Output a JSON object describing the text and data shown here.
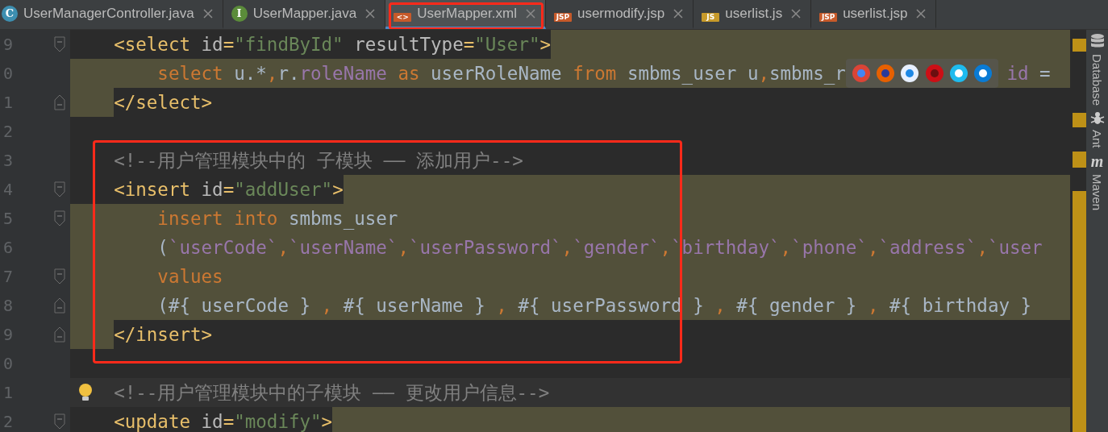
{
  "tabs": [
    {
      "label": "UserManagerController.java",
      "kind": "class",
      "icon_label": "C",
      "selected": false
    },
    {
      "label": "UserMapper.java",
      "kind": "interface",
      "icon_label": "I",
      "selected": false
    },
    {
      "label": "UserMapper.xml",
      "kind": "xml",
      "icon_label": "<>",
      "selected": true
    },
    {
      "label": "usermodify.jsp",
      "kind": "jsp",
      "icon_label": "JSP",
      "selected": false
    },
    {
      "label": "userlist.js",
      "kind": "js",
      "icon_label": "JS",
      "selected": false
    },
    {
      "label": "userlist.jsp",
      "kind": "jsp",
      "icon_label": "JSP",
      "selected": false
    }
  ],
  "editor": {
    "lines": [
      {
        "number": "9",
        "fold_start": true,
        "fold_end": false,
        "kind": "after",
        "tokens": [
          {
            "t": "    <select ",
            "kind": "tag"
          },
          {
            "t": "id",
            "kind": "attr"
          },
          {
            "t": "=",
            "kind": "tag"
          },
          {
            "t": "\"findById\"",
            "kind": "string"
          },
          {
            "t": " resultType",
            "kind": "attr"
          },
          {
            "t": "=",
            "kind": "tag"
          },
          {
            "t": "\"User\"",
            "kind": "string"
          },
          {
            "t": ">",
            "kind": "tag"
          }
        ]
      },
      {
        "number": "0",
        "fold_start": false,
        "fold_end": false,
        "kind": "full",
        "tokens": [
          {
            "t": "        select",
            "kind": "keyword"
          },
          {
            "t": " u.*",
            "kind": "plain"
          },
          {
            "t": ",",
            "kind": "keyword"
          },
          {
            "t": "r.",
            "kind": "plain"
          },
          {
            "t": "roleName",
            "kind": "field"
          },
          {
            "t": " as",
            "kind": "keyword"
          },
          {
            "t": " userRoleName ",
            "kind": "plain"
          },
          {
            "t": "from",
            "kind": "keyword"
          },
          {
            "t": " smbms_user u",
            "kind": "plain"
          },
          {
            "t": ",",
            "kind": "keyword"
          },
          {
            "t": "smbms_r",
            "kind": "plain"
          },
          {
            "kind": "browser_popup"
          },
          {
            "t": "id",
            "kind": "field"
          },
          {
            "t": " =",
            "kind": "plain"
          }
        ]
      },
      {
        "number": "1",
        "fold_start": false,
        "fold_end": true,
        "kind": "indent",
        "tokens": [
          {
            "t": "</select>",
            "kind": "tag"
          }
        ]
      },
      {
        "number": "2",
        "fold_start": false,
        "fold_end": false,
        "kind": "none"
      },
      {
        "number": "3",
        "fold_start": false,
        "fold_end": false,
        "kind": "none",
        "tokens": [
          {
            "t": "    <!--用户管理模块中的 子模块 —— 添加用户-->",
            "kind": "comment"
          }
        ]
      },
      {
        "number": "4",
        "fold_start": true,
        "fold_end": false,
        "kind": "after",
        "tokens": [
          {
            "t": "    <insert ",
            "kind": "tag"
          },
          {
            "t": "id",
            "kind": "attr"
          },
          {
            "t": "=",
            "kind": "tag"
          },
          {
            "t": "\"addUser\"",
            "kind": "string"
          },
          {
            "t": ">",
            "kind": "tag"
          }
        ]
      },
      {
        "number": "5",
        "fold_start": true,
        "fold_end": false,
        "kind": "full",
        "tokens": [
          {
            "t": "        insert into",
            "kind": "keyword"
          },
          {
            "t": " smbms_user",
            "kind": "plain"
          }
        ]
      },
      {
        "number": "6",
        "fold_start": false,
        "fold_end": false,
        "kind": "full",
        "tokens": [
          {
            "t": "        (",
            "kind": "plain"
          },
          {
            "t": "`userCode`",
            "kind": "field"
          },
          {
            "t": ",",
            "kind": "keyword"
          },
          {
            "t": "`userName`",
            "kind": "field"
          },
          {
            "t": ",",
            "kind": "keyword"
          },
          {
            "t": "`userPassword`",
            "kind": "field"
          },
          {
            "t": ",",
            "kind": "keyword"
          },
          {
            "t": "`gender`",
            "kind": "field"
          },
          {
            "t": ",",
            "kind": "keyword"
          },
          {
            "t": "`birthday`",
            "kind": "field"
          },
          {
            "t": ",",
            "kind": "keyword"
          },
          {
            "t": "`phone`",
            "kind": "field"
          },
          {
            "t": ",",
            "kind": "keyword"
          },
          {
            "t": "`address`",
            "kind": "field"
          },
          {
            "t": ",",
            "kind": "keyword"
          },
          {
            "t": "`user",
            "kind": "field"
          }
        ]
      },
      {
        "number": "7",
        "fold_start": true,
        "fold_end": false,
        "kind": "full",
        "tokens": [
          {
            "t": "        values",
            "kind": "keyword"
          }
        ]
      },
      {
        "number": "8",
        "fold_start": false,
        "fold_end": true,
        "kind": "full",
        "tokens": [
          {
            "t": "        (#{ userCode } ",
            "kind": "plain"
          },
          {
            "t": ",",
            "kind": "keyword"
          },
          {
            "t": " #{ userName } ",
            "kind": "plain"
          },
          {
            "t": ",",
            "kind": "keyword"
          },
          {
            "t": " #{ userPassword } ",
            "kind": "plain"
          },
          {
            "t": ",",
            "kind": "keyword"
          },
          {
            "t": " #{ gender } ",
            "kind": "plain"
          },
          {
            "t": ",",
            "kind": "keyword"
          },
          {
            "t": " #{ birthday }",
            "kind": "plain"
          }
        ]
      },
      {
        "number": "9",
        "fold_start": false,
        "fold_end": true,
        "kind": "indent",
        "tokens": [
          {
            "t": "</insert>",
            "kind": "tag"
          }
        ]
      },
      {
        "number": "0",
        "fold_start": false,
        "fold_end": false,
        "kind": "none"
      },
      {
        "number": "1",
        "fold_start": false,
        "fold_end": false,
        "kind": "caret",
        "tokens": [
          {
            "t": "<!--用户管理模块中的子模块 —— 更改用户信息-->",
            "kind": "comment"
          }
        ]
      },
      {
        "number": "2",
        "fold_start": true,
        "fold_end": false,
        "kind": "after",
        "tokens": [
          {
            "t": "    <update ",
            "kind": "tag"
          },
          {
            "t": "id",
            "kind": "attr"
          },
          {
            "t": "=",
            "kind": "tag"
          },
          {
            "t": "\"modify\"",
            "kind": "string"
          },
          {
            "t": ">",
            "kind": "tag"
          }
        ]
      }
    ]
  },
  "tool_windows": [
    {
      "label": "Database",
      "kind": "database"
    },
    {
      "label": "Ant",
      "kind": "ant"
    },
    {
      "label": "Maven",
      "kind": "maven",
      "icon_label": "m"
    }
  ]
}
